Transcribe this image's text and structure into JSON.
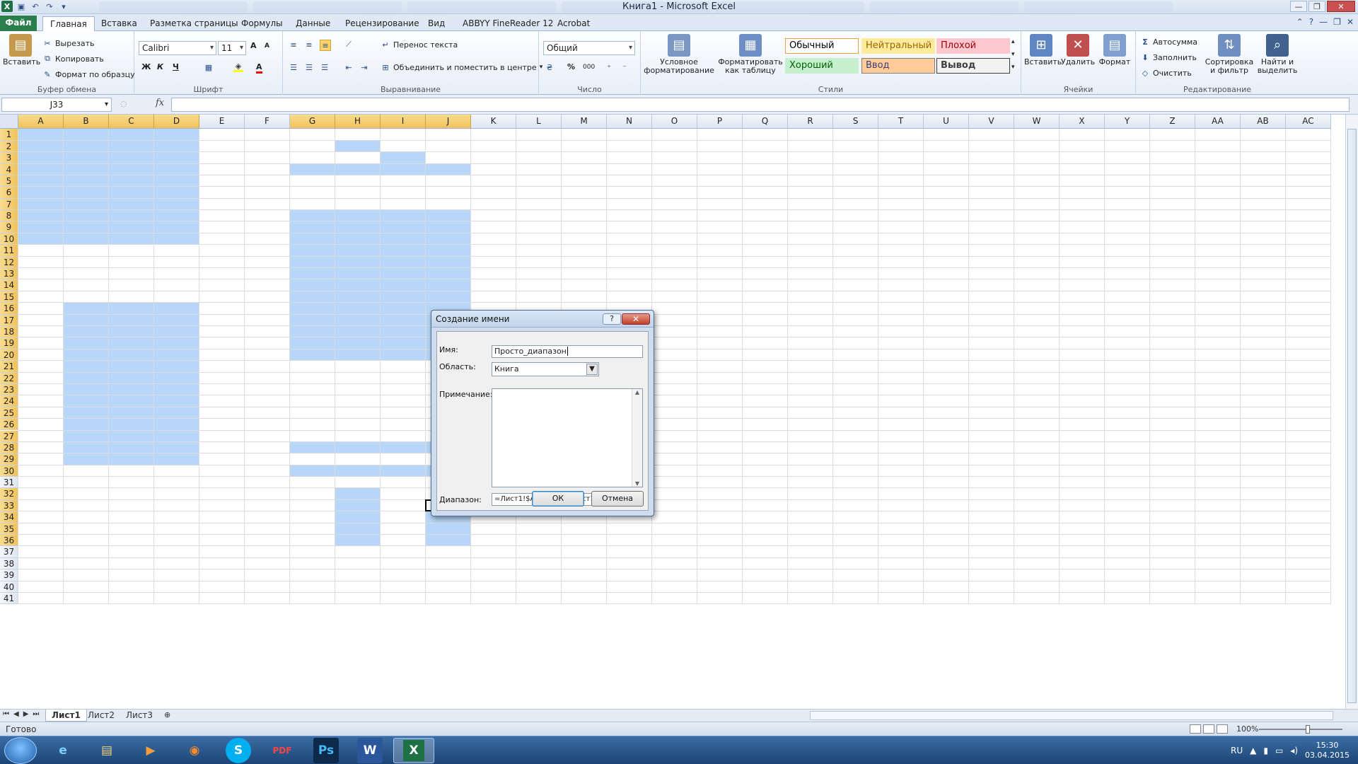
{
  "window": {
    "title": "Книга1 - Microsoft Excel",
    "min": "—",
    "max": "❐",
    "close": "✕"
  },
  "tabs": [
    {
      "label": "Файл"
    },
    {
      "label": "Главная"
    },
    {
      "label": "Вставка"
    },
    {
      "label": "Разметка страницы"
    },
    {
      "label": "Формулы"
    },
    {
      "label": "Данные"
    },
    {
      "label": "Рецензирование"
    },
    {
      "label": "Вид"
    },
    {
      "label": "ABBYY FineReader 12"
    },
    {
      "label": "Acrobat"
    }
  ],
  "ribbon": {
    "clipboard": {
      "paste": "Вставить",
      "cut": "Вырезать",
      "copy": "Копировать",
      "format_painter": "Формат по образцу",
      "label": "Буфер обмена"
    },
    "font": {
      "name": "Calibri",
      "size": "11",
      "bold": "Ж",
      "italic": "К",
      "underline": "Ч",
      "label": "Шрифт",
      "grow": "A",
      "shrink": "A",
      "color_letter": "A"
    },
    "alignment": {
      "wrap": "Перенос текста",
      "merge": "Объединить и поместить в центре",
      "label": "Выравнивание"
    },
    "number": {
      "format": "Общий",
      "percent": "%",
      "thousands": "000",
      "label": "Число"
    },
    "styles": {
      "cond": "Условное форматирование",
      "table": "Форматировать как таблицу",
      "cells": [
        {
          "label": "Обычный",
          "bg": "#ffffff",
          "fg": "#000000",
          "border": "#e8a33d"
        },
        {
          "label": "Нейтральный",
          "bg": "#ffeb9c",
          "fg": "#9c6500",
          "border": "#ffeb9c"
        },
        {
          "label": "Плохой",
          "bg": "#ffc7ce",
          "fg": "#9c0006",
          "border": "#ffc7ce"
        },
        {
          "label": "Хороший",
          "bg": "#c6efce",
          "fg": "#006100",
          "border": "#c6efce"
        },
        {
          "label": "Ввод",
          "bg": "#ffcc99",
          "fg": "#3f3f76",
          "border": "#7f7f7f"
        },
        {
          "label": "Вывод",
          "bg": "#f2f2f2",
          "fg": "#3f3f3f",
          "border": "#3f3f3f"
        }
      ],
      "label": "Стили"
    },
    "cells": {
      "insert": "Вставить",
      "delete": "Удалить",
      "format": "Формат",
      "label": "Ячейки"
    },
    "editing": {
      "autosum": "Автосумма",
      "fill": "Заполнить",
      "clear": "Очистить",
      "sort": "Сортировка и фильтр",
      "find": "Найти и выделить",
      "label": "Редактирование"
    }
  },
  "formula_bar": {
    "name_box": "J33",
    "fx": "fx",
    "content": ""
  },
  "columns": [
    "A",
    "B",
    "C",
    "D",
    "E",
    "F",
    "G",
    "H",
    "I",
    "J",
    "K",
    "L",
    "M",
    "N",
    "O",
    "P",
    "Q",
    "R",
    "S",
    "T",
    "U",
    "V",
    "W",
    "X",
    "Y",
    "Z",
    "AA",
    "AB",
    "AC"
  ],
  "selected_columns": [
    "A",
    "B",
    "C",
    "D",
    "G",
    "H",
    "I",
    "J"
  ],
  "rows": [
    "1",
    "2",
    "3",
    "4",
    "5",
    "6",
    "7",
    "8",
    "9",
    "10",
    "11",
    "12",
    "13",
    "14",
    "15",
    "16",
    "17",
    "18",
    "19",
    "20",
    "21",
    "22",
    "23",
    "24",
    "25",
    "26",
    "27",
    "28",
    "29",
    "30",
    "31",
    "32",
    "33",
    "34",
    "35",
    "36",
    "37",
    "38",
    "39",
    "40",
    "41"
  ],
  "selected_rows": [
    "1",
    "2",
    "3",
    "4",
    "5",
    "6",
    "7",
    "8",
    "9",
    "10",
    "11",
    "12",
    "13",
    "14",
    "15",
    "16",
    "17",
    "18",
    "19",
    "20",
    "21",
    "22",
    "23",
    "24",
    "25",
    "26",
    "27",
    "28",
    "29",
    "30",
    "32",
    "33",
    "34",
    "35",
    "36"
  ],
  "active_cell": "J33",
  "selection_ranges": [
    "A1:D10",
    "H2",
    "I3",
    "G4:J4",
    "G8:J20",
    "B16:D29",
    "G28:J28",
    "G30:J30",
    "H32:H36",
    "J33:J36"
  ],
  "dialog": {
    "title": "Создание имени",
    "help": "?",
    "close": "✕",
    "name_label": "Имя:",
    "name_value": "Просто_диапазон",
    "scope_label": "Область:",
    "scope_value": "Книга",
    "comment_label": "Примечание:",
    "range_label": "Диапазон:",
    "range_value": "=Лист1!$A$1:$D$10;Лист1!$G$8:$J$",
    "ok": "ОК",
    "cancel": "Отмена"
  },
  "sheets": [
    {
      "label": "Лист1"
    },
    {
      "label": "Лист2"
    },
    {
      "label": "Лист3"
    }
  ],
  "status": {
    "text": "Готово",
    "zoom": "100%"
  },
  "taskbar": {
    "lang": "RU",
    "time": "15:30",
    "date": "03.04.2015",
    "apps": [
      "e",
      "▤",
      "▶",
      "◉",
      "S",
      "PDF",
      "Ps",
      "W",
      "X"
    ]
  }
}
